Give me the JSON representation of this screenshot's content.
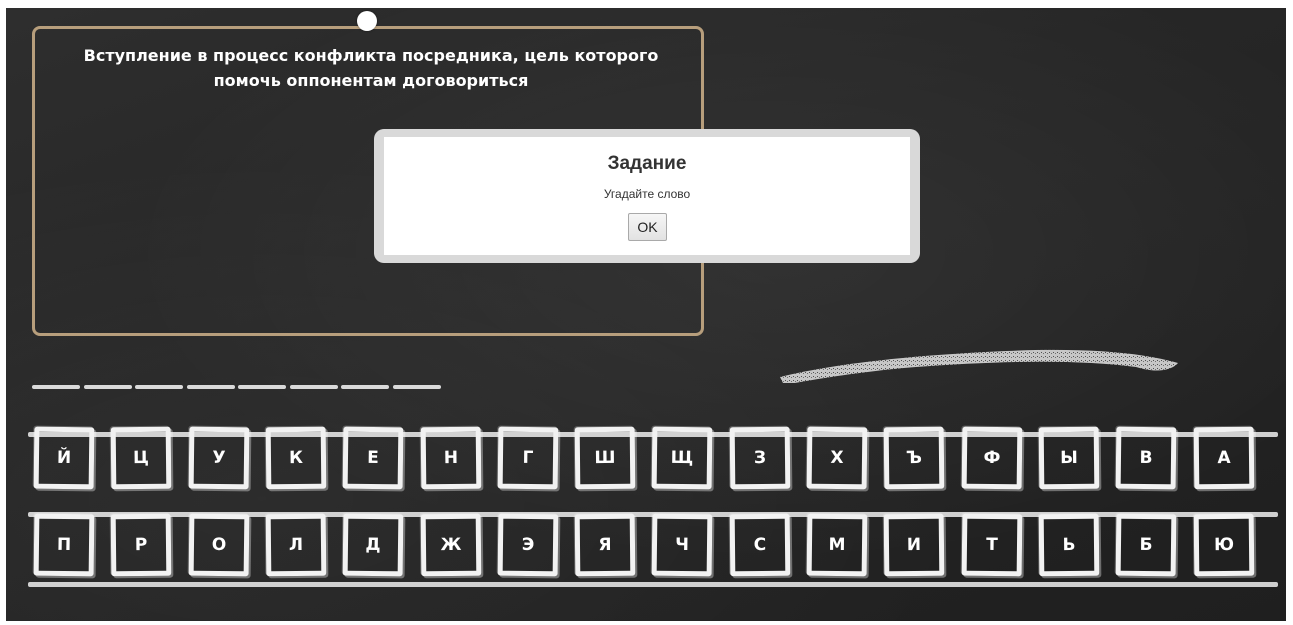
{
  "question": {
    "text": "Вступление в процесс конфликта посредника, цель которого помочь оппонентам договориться"
  },
  "answer": {
    "blank_count": 8
  },
  "keyboard": {
    "row1": [
      "Й",
      "Ц",
      "У",
      "К",
      "Е",
      "Н",
      "Г",
      "Ш",
      "Щ",
      "З",
      "Х",
      "Ъ",
      "Ф",
      "Ы",
      "В",
      "А"
    ],
    "row2": [
      "П",
      "Р",
      "О",
      "Л",
      "Д",
      "Ж",
      "Э",
      "Я",
      "Ч",
      "С",
      "М",
      "И",
      "Т",
      "Ь",
      "Б",
      "Ю"
    ]
  },
  "modal": {
    "title": "Задание",
    "text": "Угадайте слово",
    "ok_label": "OK"
  },
  "colors": {
    "board": "#262626",
    "frame": "#b79e7c",
    "chalk": "#f2f2f2"
  }
}
